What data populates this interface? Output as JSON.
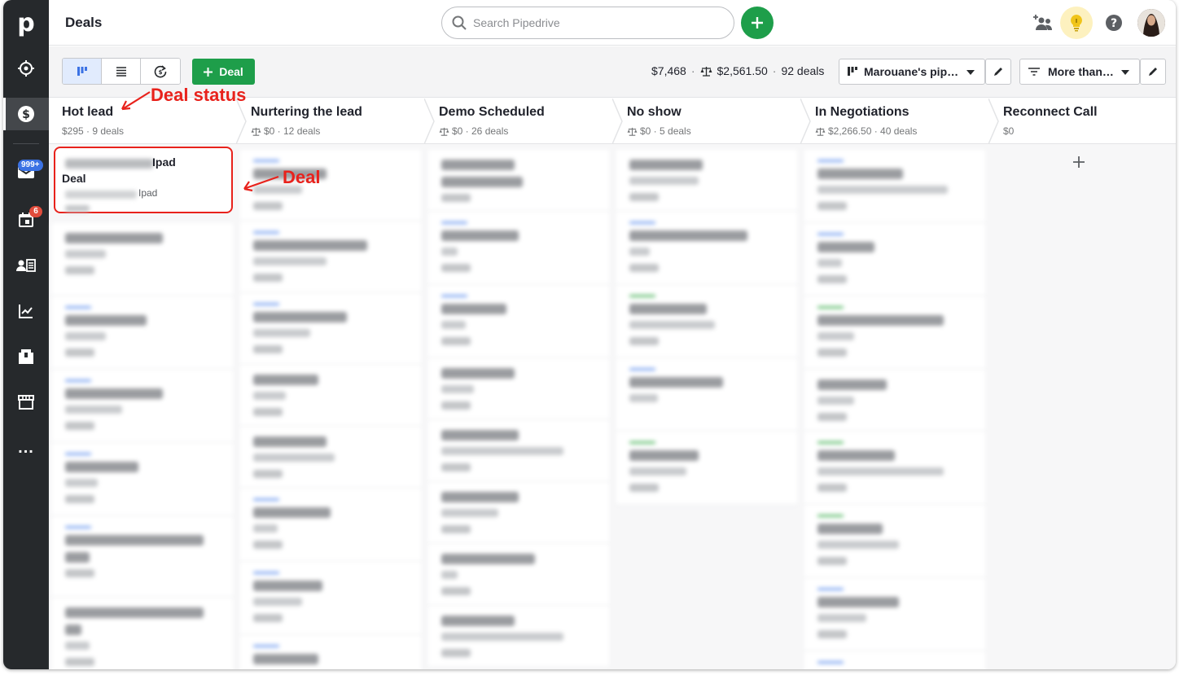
{
  "app": {
    "name": "Pipedrive"
  },
  "sidebar": {
    "logo": "p",
    "items": [
      {
        "name": "leads",
        "icon": "target-icon"
      },
      {
        "name": "deals",
        "icon": "dollar-icon",
        "active": true
      },
      {
        "name": "mail",
        "icon": "mail-icon",
        "badge": "999+"
      },
      {
        "name": "activities",
        "icon": "calendar-icon",
        "badge": "6"
      },
      {
        "name": "contacts",
        "icon": "contacts-icon"
      },
      {
        "name": "insights",
        "icon": "chart-icon"
      },
      {
        "name": "products",
        "icon": "box-icon"
      },
      {
        "name": "marketplace",
        "icon": "store-icon"
      },
      {
        "name": "more",
        "icon": "more-icon",
        "label": "..."
      }
    ]
  },
  "header": {
    "title": "Deals",
    "search_placeholder": "Search Pipedrive"
  },
  "toolbar": {
    "deal_button": "Deal",
    "total_value": "$7,468",
    "weighted_value": "$2,561.50",
    "deal_count": "92 deals",
    "separator": "·",
    "pipeline_select": "Marouane's pip…",
    "filter_select": "More than…"
  },
  "stages": [
    {
      "title": "Hot lead",
      "sub": "$295 · 9 deals",
      "weighted": false
    },
    {
      "title": "Nurtering the lead",
      "sub": "$0 · 12 deals",
      "weighted": true
    },
    {
      "title": "Demo Scheduled",
      "sub": "$0 · 26 deals",
      "weighted": true
    },
    {
      "title": "No show",
      "sub": "$0 · 5 deals",
      "weighted": true
    },
    {
      "title": "In Negotiations",
      "sub": "$2,266.50 · 40 deals",
      "weighted": true
    },
    {
      "title": "Reconnect Call",
      "sub": "$0",
      "weighted": false
    }
  ],
  "highlight_card": {
    "line1_suffix": "Ipad",
    "line2": "Deal",
    "line3_suffix": "Ipad"
  },
  "annotations": {
    "deal_status": "Deal status",
    "deal": "Deal"
  },
  "colors": {
    "accent_green": "#1e9e4a",
    "annotation_red": "#e8221c",
    "sidebar": "#26292c",
    "stripe_blue": "#7aa2f0",
    "stripe_green": "#5dbb6b"
  }
}
